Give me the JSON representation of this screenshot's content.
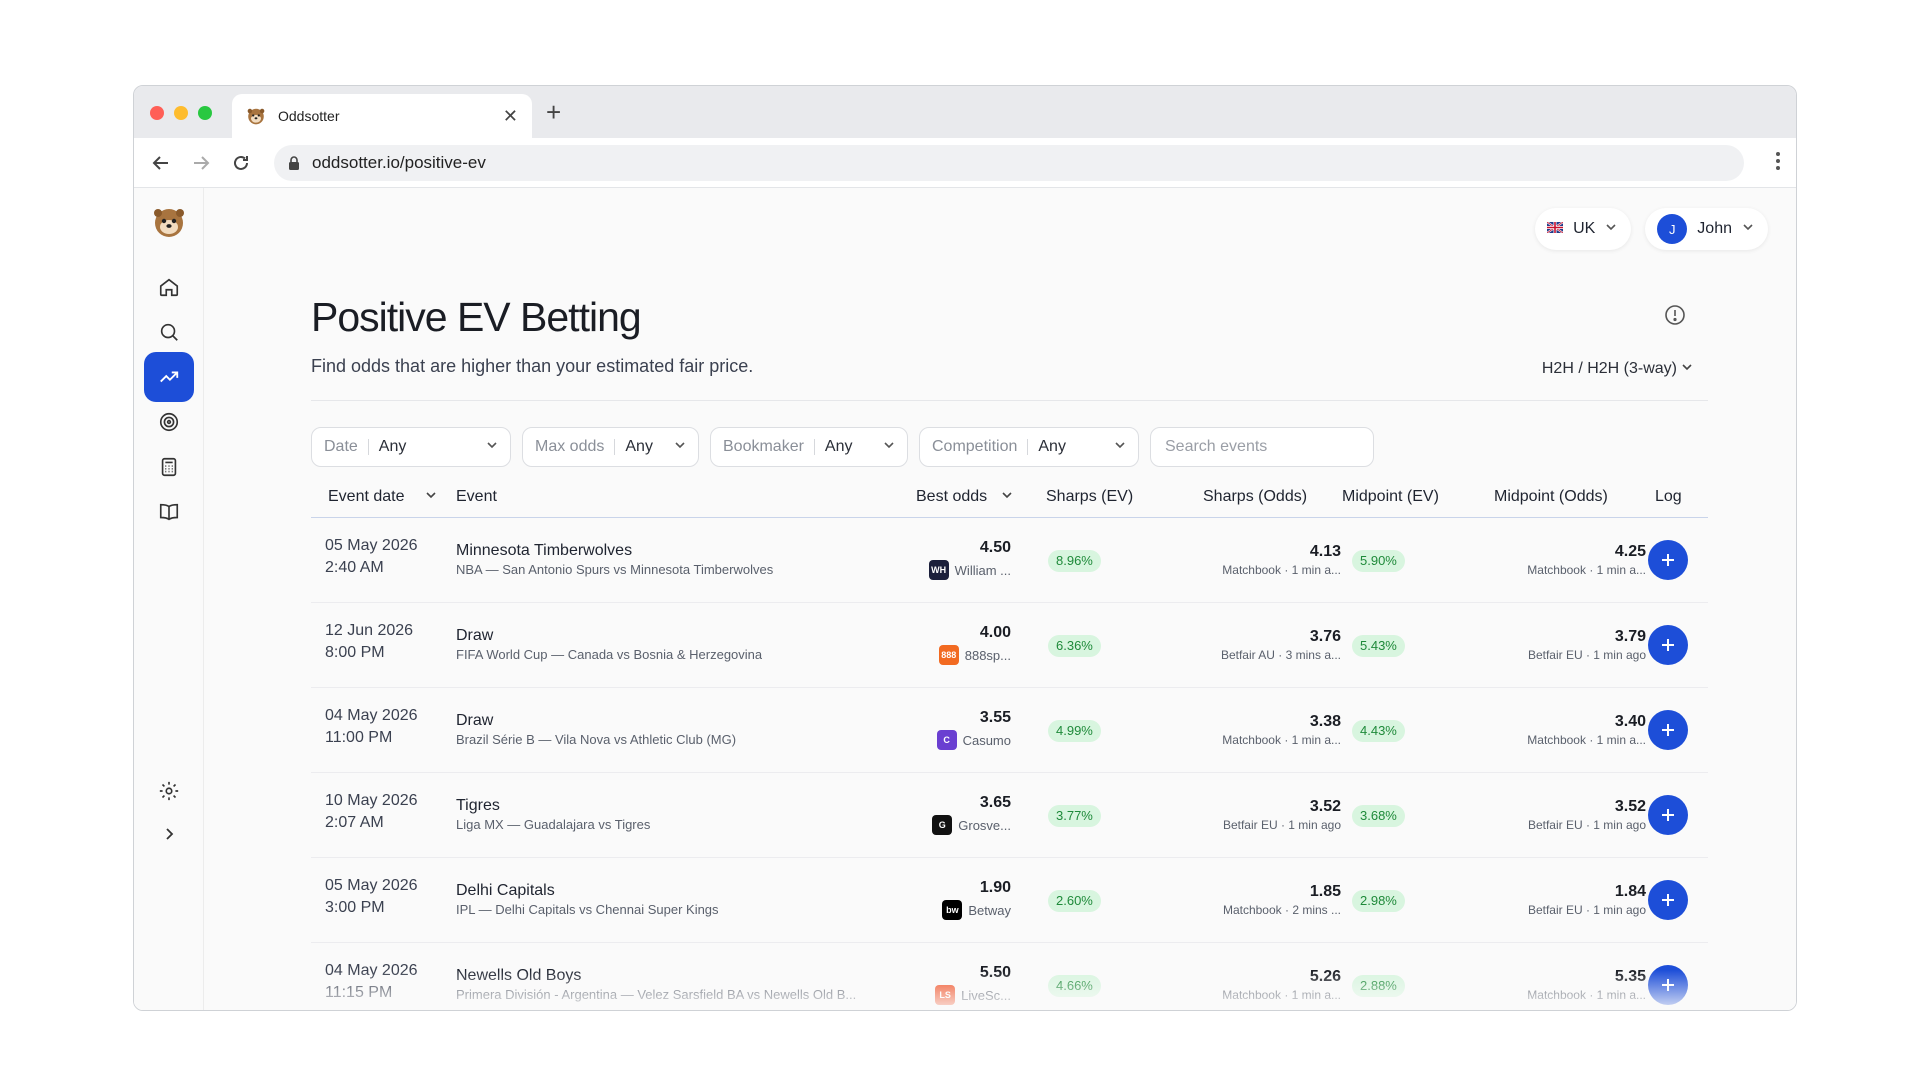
{
  "browser": {
    "tab_title": "Oddsotter",
    "url": "oddsotter.io/positive-ev"
  },
  "header": {
    "region": "UK",
    "user_initial": "J",
    "user_name": "John"
  },
  "page": {
    "title": "Positive EV Betting",
    "subtitle": "Find odds that are higher than your estimated fair price.",
    "market": "H2H / H2H (3-way)"
  },
  "filters": {
    "date": {
      "label": "Date",
      "value": "Any"
    },
    "max_odds": {
      "label": "Max odds",
      "value": "Any"
    },
    "bookmaker": {
      "label": "Bookmaker",
      "value": "Any"
    },
    "competition": {
      "label": "Competition",
      "value": "Any"
    },
    "search_placeholder": "Search events"
  },
  "table": {
    "headers": {
      "event_date": "Event date",
      "event": "Event",
      "best_odds": "Best odds",
      "sharps_ev": "Sharps (EV)",
      "sharps_odds": "Sharps (Odds)",
      "midpoint_ev": "Midpoint (EV)",
      "midpoint_odds": "Midpoint (Odds)",
      "log": "Log"
    },
    "rows": [
      {
        "date": "05 May 2026",
        "time": "2:40 AM",
        "title": "Minnesota Timberwolves",
        "sub": "NBA — San Antonio Spurs vs Minnesota Timberwolves",
        "best": "4.50",
        "book": "William ...",
        "book_color": "#1b1f3b",
        "book_mark": "WH",
        "sharps_ev": "8.96%",
        "sharps_odds": "4.13",
        "sharps_src": "Matchbook · 1 min a...",
        "mid_ev": "5.90%",
        "mid_odds": "4.25",
        "mid_src": "Matchbook · 1 min a..."
      },
      {
        "date": "12 Jun 2026",
        "time": "8:00 PM",
        "title": "Draw",
        "sub": "FIFA World Cup — Canada vs Bosnia & Herzegovina",
        "best": "4.00",
        "book": "888sp...",
        "book_color": "#f26a21",
        "book_mark": "888",
        "sharps_ev": "6.36%",
        "sharps_odds": "3.76",
        "sharps_src": "Betfair AU · 3 mins a...",
        "mid_ev": "5.43%",
        "mid_odds": "3.79",
        "mid_src": "Betfair EU · 1 min ago"
      },
      {
        "date": "04 May 2026",
        "time": "11:00 PM",
        "title": "Draw",
        "sub": "Brazil Série B — Vila Nova vs Athletic Club (MG)",
        "best": "3.55",
        "book": "Casumo",
        "book_color": "#6a3fd1",
        "book_mark": "C",
        "sharps_ev": "4.99%",
        "sharps_odds": "3.38",
        "sharps_src": "Matchbook · 1 min a...",
        "mid_ev": "4.43%",
        "mid_odds": "3.40",
        "mid_src": "Matchbook · 1 min a..."
      },
      {
        "date": "10 May 2026",
        "time": "2:07 AM",
        "title": "Tigres",
        "sub": "Liga MX — Guadalajara vs Tigres",
        "best": "3.65",
        "book": "Grosve...",
        "book_color": "#111111",
        "book_mark": "G",
        "sharps_ev": "3.77%",
        "sharps_odds": "3.52",
        "sharps_src": "Betfair EU · 1 min ago",
        "mid_ev": "3.68%",
        "mid_odds": "3.52",
        "mid_src": "Betfair EU · 1 min ago"
      },
      {
        "date": "05 May 2026",
        "time": "3:00 PM",
        "title": "Delhi Capitals",
        "sub": "IPL — Delhi Capitals vs Chennai Super Kings",
        "best": "1.90",
        "book": "Betway",
        "book_color": "#000000",
        "book_mark": "bw",
        "sharps_ev": "2.60%",
        "sharps_odds": "1.85",
        "sharps_src": "Matchbook · 2 mins ...",
        "mid_ev": "2.98%",
        "mid_odds": "1.84",
        "mid_src": "Betfair EU · 1 min ago"
      },
      {
        "date": "04 May 2026",
        "time": "11:15 PM",
        "title": "Newells Old Boys",
        "sub": "Primera División - Argentina — Velez Sarsfield BA vs Newells Old B...",
        "best": "5.50",
        "book": "LiveSc...",
        "book_color": "#f04e23",
        "book_mark": "LS",
        "sharps_ev": "4.66%",
        "sharps_odds": "5.26",
        "sharps_src": "Matchbook · 1 min a...",
        "mid_ev": "2.88%",
        "mid_odds": "5.35",
        "mid_src": "Matchbook · 1 min a..."
      }
    ]
  },
  "colors": {
    "accent": "#1d4ed8",
    "ev_badge_bg": "#d8f5df",
    "ev_badge_text": "#1f8a3a"
  },
  "icons": [
    "otter-logo-icon",
    "home-icon",
    "search-icon",
    "trending-up-icon",
    "target-icon",
    "calculator-icon",
    "book-icon",
    "settings-icon",
    "chevron-right-icon",
    "info-icon",
    "plus-icon",
    "chevron-down-icon",
    "lock-icon",
    "uk-flag-icon"
  ]
}
